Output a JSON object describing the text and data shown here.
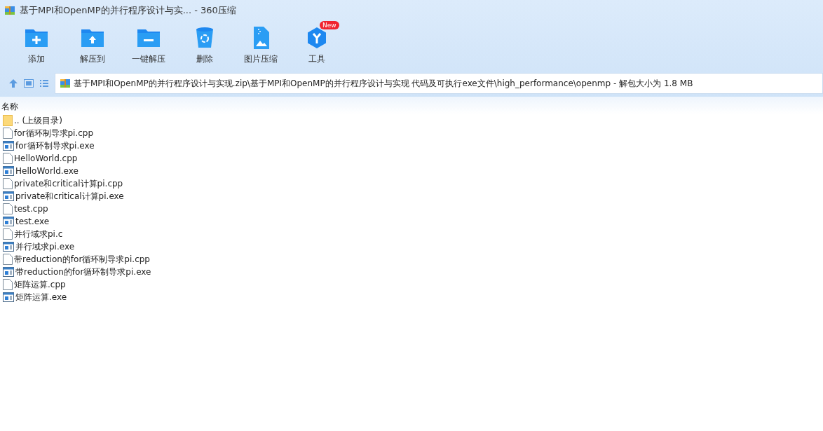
{
  "window": {
    "title": "基于MPI和OpenMP的并行程序设计与实... - 360压缩"
  },
  "toolbar": [
    {
      "label": "添加",
      "kind": "add"
    },
    {
      "label": "解压到",
      "kind": "extract"
    },
    {
      "label": "一键解压",
      "kind": "quick"
    },
    {
      "label": "删除",
      "kind": "delete"
    },
    {
      "label": "图片压缩",
      "kind": "image"
    },
    {
      "label": "工具",
      "kind": "tools",
      "badge": "New"
    }
  ],
  "address_bar": {
    "path": "基于MPI和OpenMP的并行程序设计与实现.zip\\基于MPI和OpenMP的并行程序设计与实现 代码及可执行exe文件\\high_performance\\openmp - 解包大小为 1.8 MB"
  },
  "file_list": {
    "columns": [
      "名称"
    ],
    "rows": [
      {
        "name": ".. (上级目录)",
        "kind": "folder"
      },
      {
        "name": "for循环制导求pi.cpp",
        "kind": "file"
      },
      {
        "name": "for循环制导求pi.exe",
        "kind": "exe"
      },
      {
        "name": "HelloWorld.cpp",
        "kind": "file"
      },
      {
        "name": "HelloWorld.exe",
        "kind": "exe"
      },
      {
        "name": "private和critical计算pi.cpp",
        "kind": "file"
      },
      {
        "name": "private和critical计算pi.exe",
        "kind": "exe"
      },
      {
        "name": "test.cpp",
        "kind": "file"
      },
      {
        "name": "test.exe",
        "kind": "exe"
      },
      {
        "name": "并行域求pi.c",
        "kind": "file"
      },
      {
        "name": "并行域求pi.exe",
        "kind": "exe"
      },
      {
        "name": "带reduction的for循环制导求pi.cpp",
        "kind": "file"
      },
      {
        "name": "带reduction的for循环制导求pi.exe",
        "kind": "exe"
      },
      {
        "name": "矩阵运算.cpp",
        "kind": "file"
      },
      {
        "name": "矩阵运算.exe",
        "kind": "exe"
      }
    ]
  }
}
